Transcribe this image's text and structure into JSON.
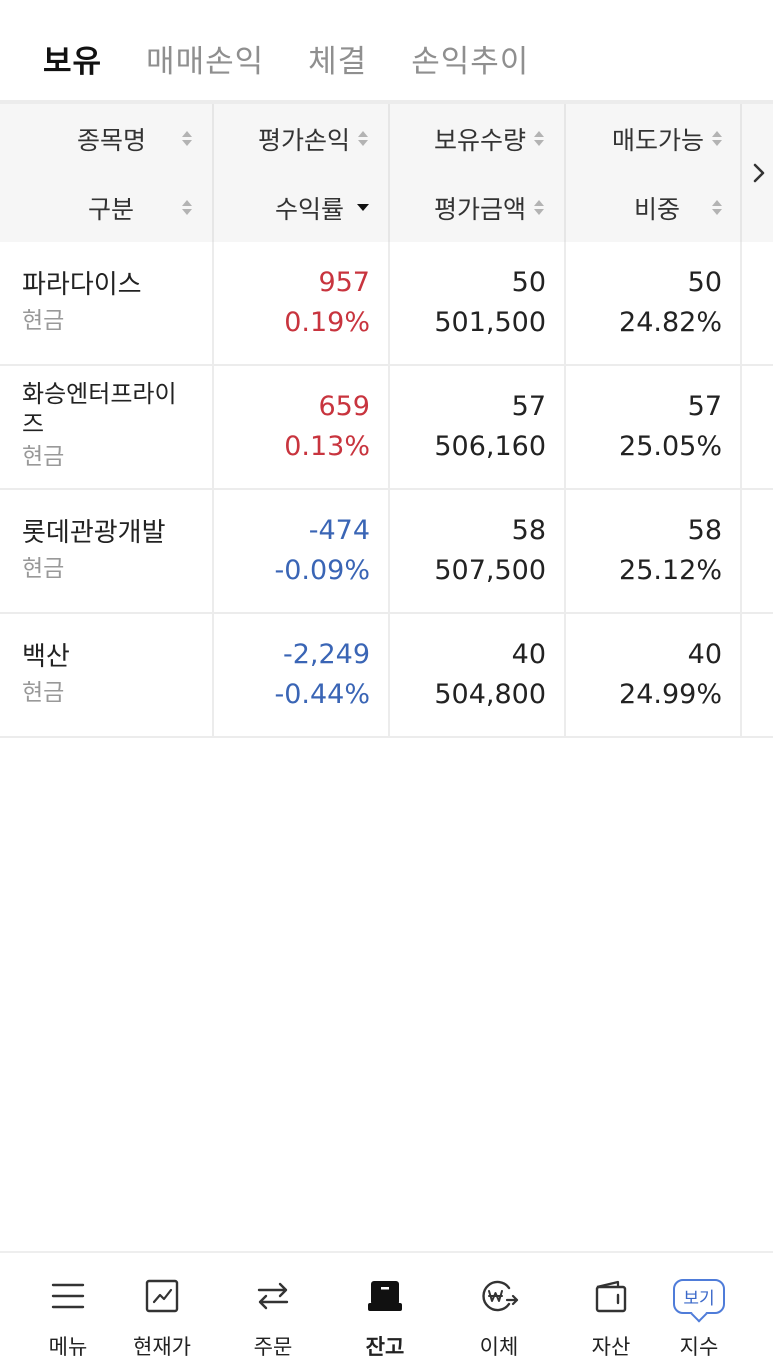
{
  "tabs": [
    {
      "label": "보유",
      "active": true
    },
    {
      "label": "매매손익",
      "active": false
    },
    {
      "label": "체결",
      "active": false
    },
    {
      "label": "손익추이",
      "active": false
    }
  ],
  "header": {
    "row1": [
      "종목명",
      "평가손익",
      "보유수량",
      "매도가능"
    ],
    "row2": [
      "구분",
      "수익률",
      "평가금액",
      "비중"
    ],
    "sorted_column": "수익률",
    "sort_direction": "desc"
  },
  "holdings": [
    {
      "name": "파라다이스",
      "type": "현금",
      "pnl": "957",
      "return_rate": "0.19%",
      "quantity": "50",
      "eval_amount": "501,500",
      "sellable": "50",
      "weight": "24.82%",
      "direction": "up"
    },
    {
      "name": "화승엔터프라이즈",
      "type": "현금",
      "pnl": "659",
      "return_rate": "0.13%",
      "quantity": "57",
      "eval_amount": "506,160",
      "sellable": "57",
      "weight": "25.05%",
      "direction": "up"
    },
    {
      "name": "롯데관광개발",
      "type": "현금",
      "pnl": "-474",
      "return_rate": "-0.09%",
      "quantity": "58",
      "eval_amount": "507,500",
      "sellable": "58",
      "weight": "25.12%",
      "direction": "down"
    },
    {
      "name": "백산",
      "type": "현금",
      "pnl": "-2,249",
      "return_rate": "-0.44%",
      "quantity": "40",
      "eval_amount": "504,800",
      "sellable": "40",
      "weight": "24.99%",
      "direction": "down"
    }
  ],
  "colors": {
    "up": "#c8343e",
    "down": "#3a65b5",
    "accent": "#4f7cd9"
  },
  "bottom_nav": [
    {
      "label": "메뉴",
      "icon": "menu-icon"
    },
    {
      "label": "현재가",
      "icon": "chart-icon"
    },
    {
      "label": "주문",
      "icon": "order-icon"
    },
    {
      "label": "잔고",
      "icon": "balance-icon",
      "active": true
    },
    {
      "label": "이체",
      "icon": "transfer-icon"
    },
    {
      "label": "자산",
      "icon": "wallet-icon"
    },
    {
      "label": "지수",
      "icon": "index-icon",
      "badge": "보기"
    }
  ]
}
